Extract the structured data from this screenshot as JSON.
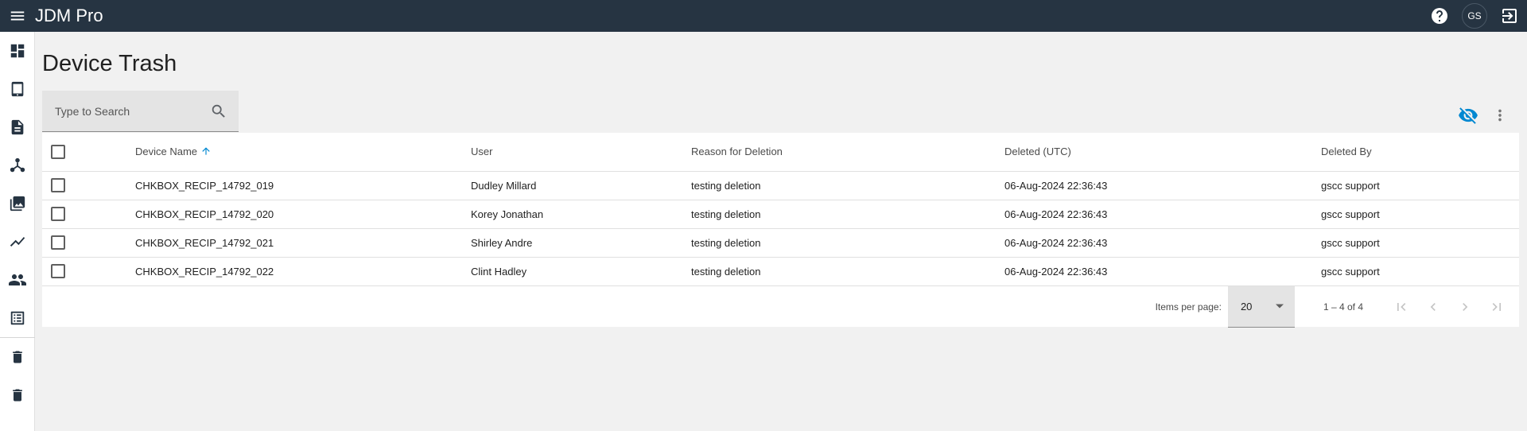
{
  "app": {
    "title": "JDM Pro"
  },
  "header": {
    "avatar_initials": "GS"
  },
  "page": {
    "title": "Device Trash"
  },
  "search": {
    "placeholder": "Type to Search"
  },
  "table": {
    "columns": {
      "device_name": "Device Name",
      "user": "User",
      "reason": "Reason for Deletion",
      "deleted": "Deleted (UTC)",
      "deleted_by": "Deleted By"
    },
    "sort": {
      "column": "device_name",
      "direction": "ascending"
    },
    "rows": [
      {
        "device_name": "CHKBOX_RECIP_14792_019",
        "user": "Dudley Millard",
        "reason": "testing deletion",
        "deleted": "06-Aug-2024 22:36:43",
        "deleted_by": "gscc support"
      },
      {
        "device_name": "CHKBOX_RECIP_14792_020",
        "user": "Korey Jonathan",
        "reason": "testing deletion",
        "deleted": "06-Aug-2024 22:36:43",
        "deleted_by": "gscc support"
      },
      {
        "device_name": "CHKBOX_RECIP_14792_021",
        "user": "Shirley Andre",
        "reason": "testing deletion",
        "deleted": "06-Aug-2024 22:36:43",
        "deleted_by": "gscc support"
      },
      {
        "device_name": "CHKBOX_RECIP_14792_022",
        "user": "Clint Hadley",
        "reason": "testing deletion",
        "deleted": "06-Aug-2024 22:36:43",
        "deleted_by": "gscc support"
      }
    ]
  },
  "paginator": {
    "items_per_page_label": "Items per page:",
    "items_per_page_value": "20",
    "range_label": "1 – 4 of 4"
  },
  "icons": {
    "menu": "menu-icon",
    "help": "help-icon",
    "logout": "logout-icon",
    "search": "search-icon",
    "visibility_off": "visibility-off-icon",
    "more": "more-vert-icon",
    "sidebar": [
      "dashboard-icon",
      "tablet-icon",
      "document-icon",
      "hub-icon",
      "photo-library-icon",
      "trending-icon",
      "people-icon",
      "list-alt-icon",
      "trash-icon",
      "trash-icon"
    ]
  },
  "colors": {
    "topbar": "#263442",
    "accent": "#0288d1",
    "background": "#f1f1f1"
  }
}
